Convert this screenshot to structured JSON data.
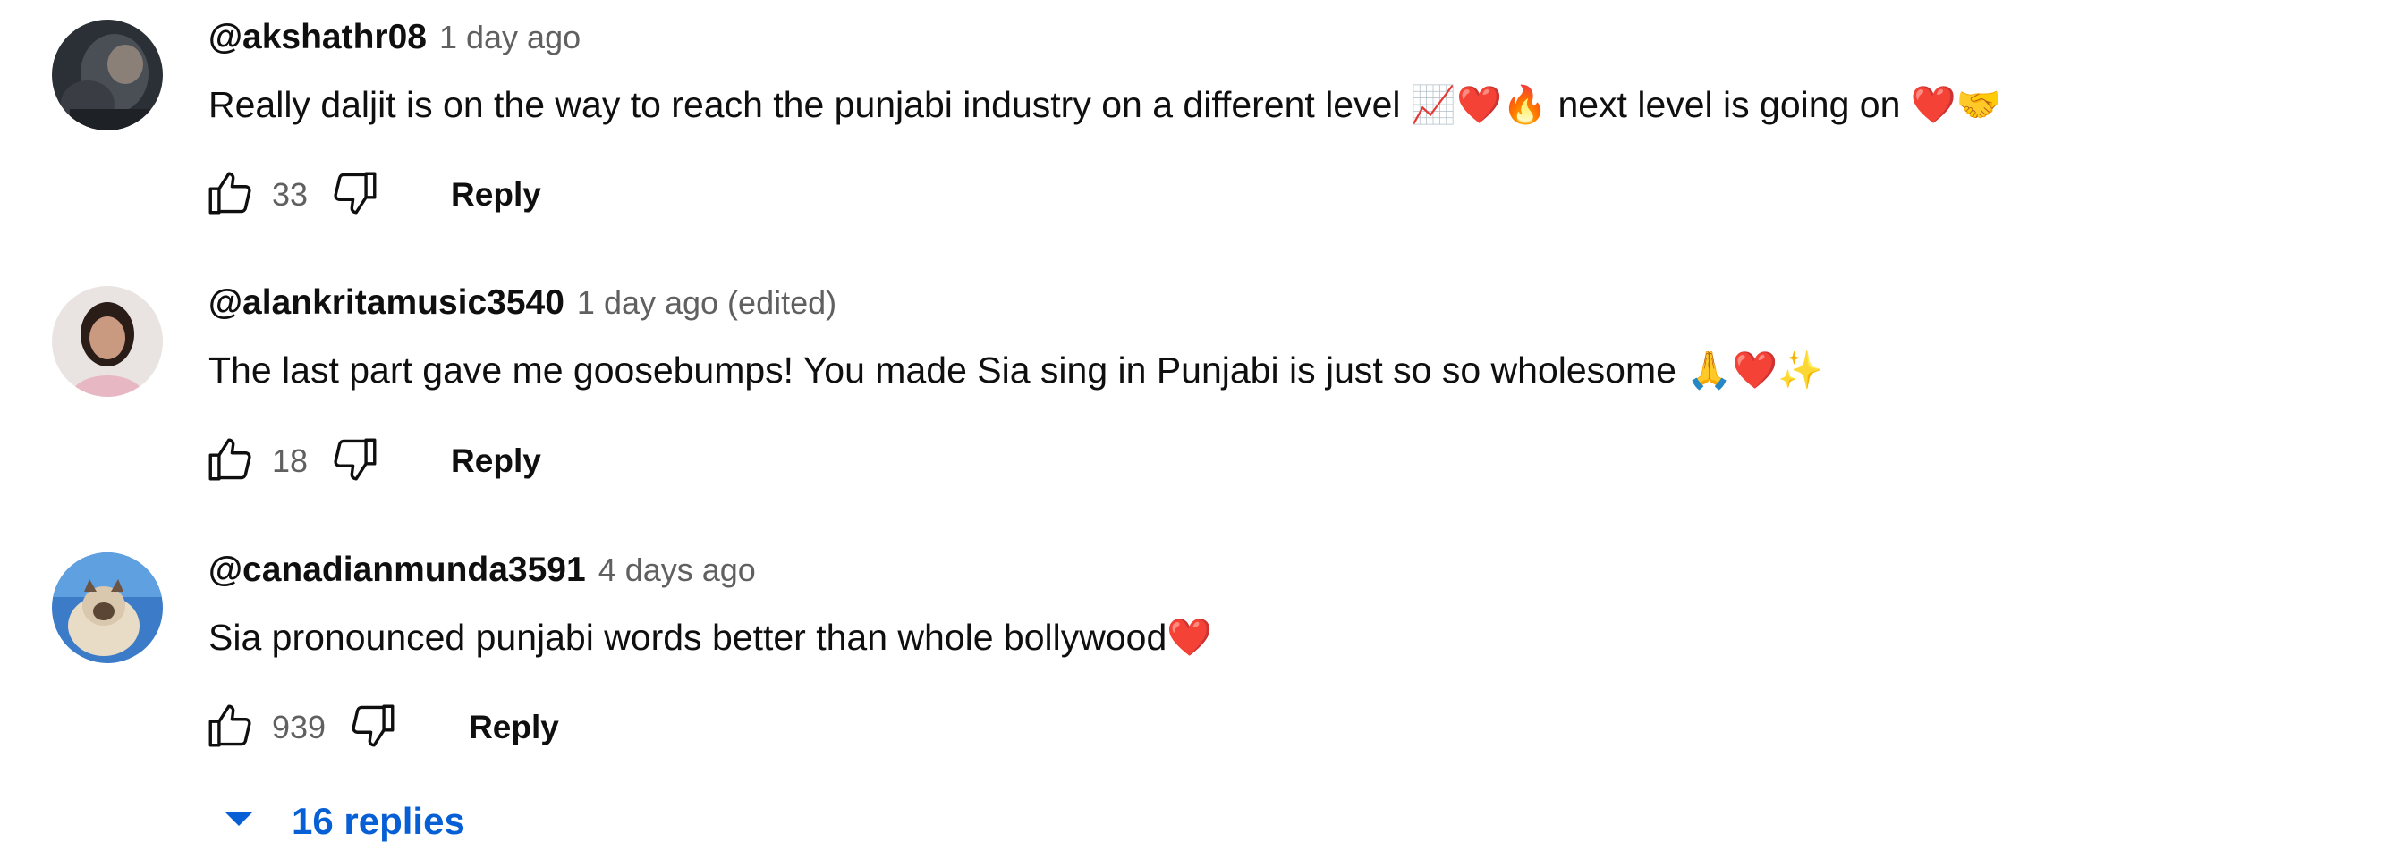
{
  "comments": [
    {
      "author": "@akshathr08",
      "time": "1 day ago",
      "text": "Really daljit is on the way to reach the punjabi industry on a different level 📈❤️🔥 next level is going on ❤️🤝",
      "likes": "33",
      "reply_label": "Reply"
    },
    {
      "author": "@alankritamusic3540",
      "time": "1 day ago (edited)",
      "text": "The last part gave me goosebumps! You made Sia sing in Punjabi is just so so wholesome 🙏❤️✨",
      "likes": "18",
      "reply_label": "Reply"
    },
    {
      "author": "@canadianmunda3591",
      "time": "4 days ago",
      "text": "Sia pronounced punjabi words better than whole bollywood❤️",
      "likes": "939",
      "reply_label": "Reply"
    }
  ],
  "replies_toggle": {
    "label": "16 replies",
    "icon": "caret-down-icon",
    "color": "#065fd4"
  },
  "colors": {
    "author": "#0f0f0f",
    "timestamp": "#606060",
    "link": "#065fd4"
  }
}
